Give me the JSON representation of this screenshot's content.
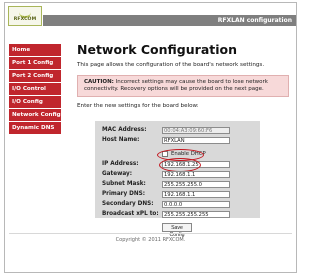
{
  "brand": {
    "logo_text": "RFXCOM",
    "app_title": "RFXLAN configuration",
    "colors": {
      "nav_background": "#c0262d",
      "header_bar": "#7f7f7f",
      "warning_background": "#f7d9d9",
      "panel_background": "#d9d9d9",
      "highlight": "#c2151d"
    }
  },
  "sidebar": {
    "items": [
      {
        "label": "Home"
      },
      {
        "label": "Port 1 Config"
      },
      {
        "label": "Port 2 Config"
      },
      {
        "label": "I/O Control"
      },
      {
        "label": "I/O Config"
      },
      {
        "label": "Network Config"
      },
      {
        "label": "Dynamic DNS"
      }
    ]
  },
  "main": {
    "title": "Network Configuration",
    "subtitle": "This page allows the configuration of the board's network settings.",
    "warning_prefix": "CAUTION:",
    "warning_text": " Incorrect settings may cause the board to lose network connectivity. Recovery options will be provided on the next page.",
    "instructions": "Enter the new settings for the board below:"
  },
  "form": {
    "mac_label": "MAC Address:",
    "mac_value": "00:04:A3:09:60:F6",
    "host_label": "Host Name:",
    "host_value": "RFXLAN",
    "dhcp_label": "Enable DHCP",
    "ip_label": "IP Address:",
    "ip_value": "192.168.1.25",
    "gateway_label": "Gateway:",
    "gateway_value": "192.168.1.1",
    "subnet_label": "Subnet Mask:",
    "subnet_value": "255.255.255.0",
    "primary_dns_label": "Primary DNS:",
    "primary_dns_value": "192.168.1.1",
    "secondary_dns_label": "Secondary DNS:",
    "secondary_dns_value": "0.0.0.0",
    "broadcast_label": "Broadcast xPL to:",
    "broadcast_value": "255.255.255.255",
    "save_button": "Save Config"
  },
  "footer": {
    "copyright": "Copyright © 2011 RFXCOM."
  }
}
